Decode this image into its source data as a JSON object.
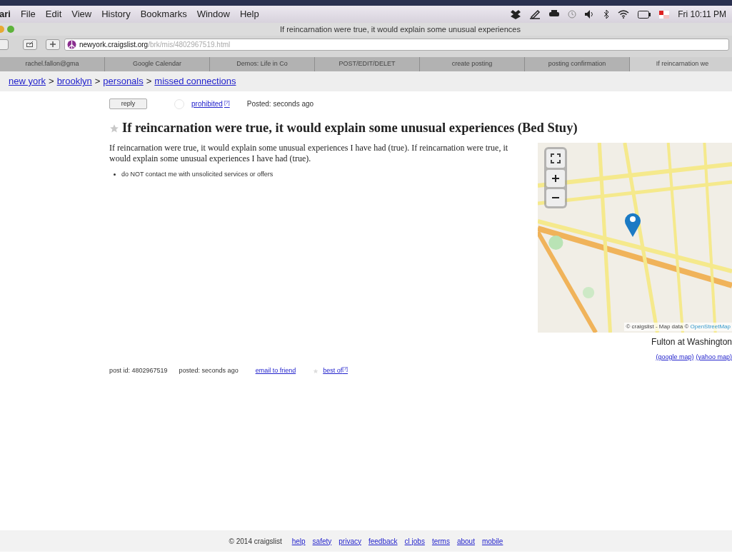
{
  "menu_bar": {
    "items": [
      "ari",
      "File",
      "Edit",
      "View",
      "History",
      "Bookmarks",
      "Window",
      "Help"
    ],
    "clock": "Fri 10:11 PM"
  },
  "window": {
    "title": "If reincarnation were true, it would explain some unusual experiences"
  },
  "toolbar": {
    "url_host": "newyork.craigslist.org",
    "url_path": "/brk/mis/4802967519.html"
  },
  "tabs": [
    {
      "label": "rachel.fallon@gma",
      "selected": false
    },
    {
      "label": "Google Calendar",
      "selected": false
    },
    {
      "label": "Demos: Life in Co",
      "selected": false
    },
    {
      "label": "POST/EDIT/DELET",
      "selected": false
    },
    {
      "label": "create posting",
      "selected": false
    },
    {
      "label": "posting confirmation",
      "selected": false
    },
    {
      "label": "If reincarnation we",
      "selected": true
    }
  ],
  "breadcrumb": {
    "separator": ">",
    "links": [
      "new york",
      "brooklyn",
      "personals",
      "missed connections"
    ]
  },
  "posting": {
    "reply_button": "reply",
    "flag_checked": false,
    "flag_label": "prohibited",
    "flag_help": "[?]",
    "posted": "Posted: seconds ago",
    "title": "If reincarnation were true, it would explain some unusual experiences (Bed Stuy)",
    "body": "If reincarnation were true, it would explain some unusual experiences I have had (true). If reincarnation were true, it would explain some unusual experiences I have had (true).",
    "notices": [
      "do NOT contact me with unsolicited services or offers"
    ],
    "map": {
      "attribution": "© craigslist - Map data ©",
      "attribution_link": "OpenStreetMap",
      "address": "Fulton at Washington",
      "links": [
        "(google map)",
        "(yahoo map)"
      ]
    },
    "post_id": "post id: 4802967519",
    "posted_footer": "posted: seconds ago",
    "email_link": "email to friend",
    "best_of": "best of",
    "best_of_help": "[?]"
  },
  "footer": {
    "copyright": "© 2014 craigslist",
    "links": [
      "help",
      "safety",
      "privacy",
      "feedback",
      "cl jobs",
      "terms",
      "about",
      "mobile"
    ]
  }
}
